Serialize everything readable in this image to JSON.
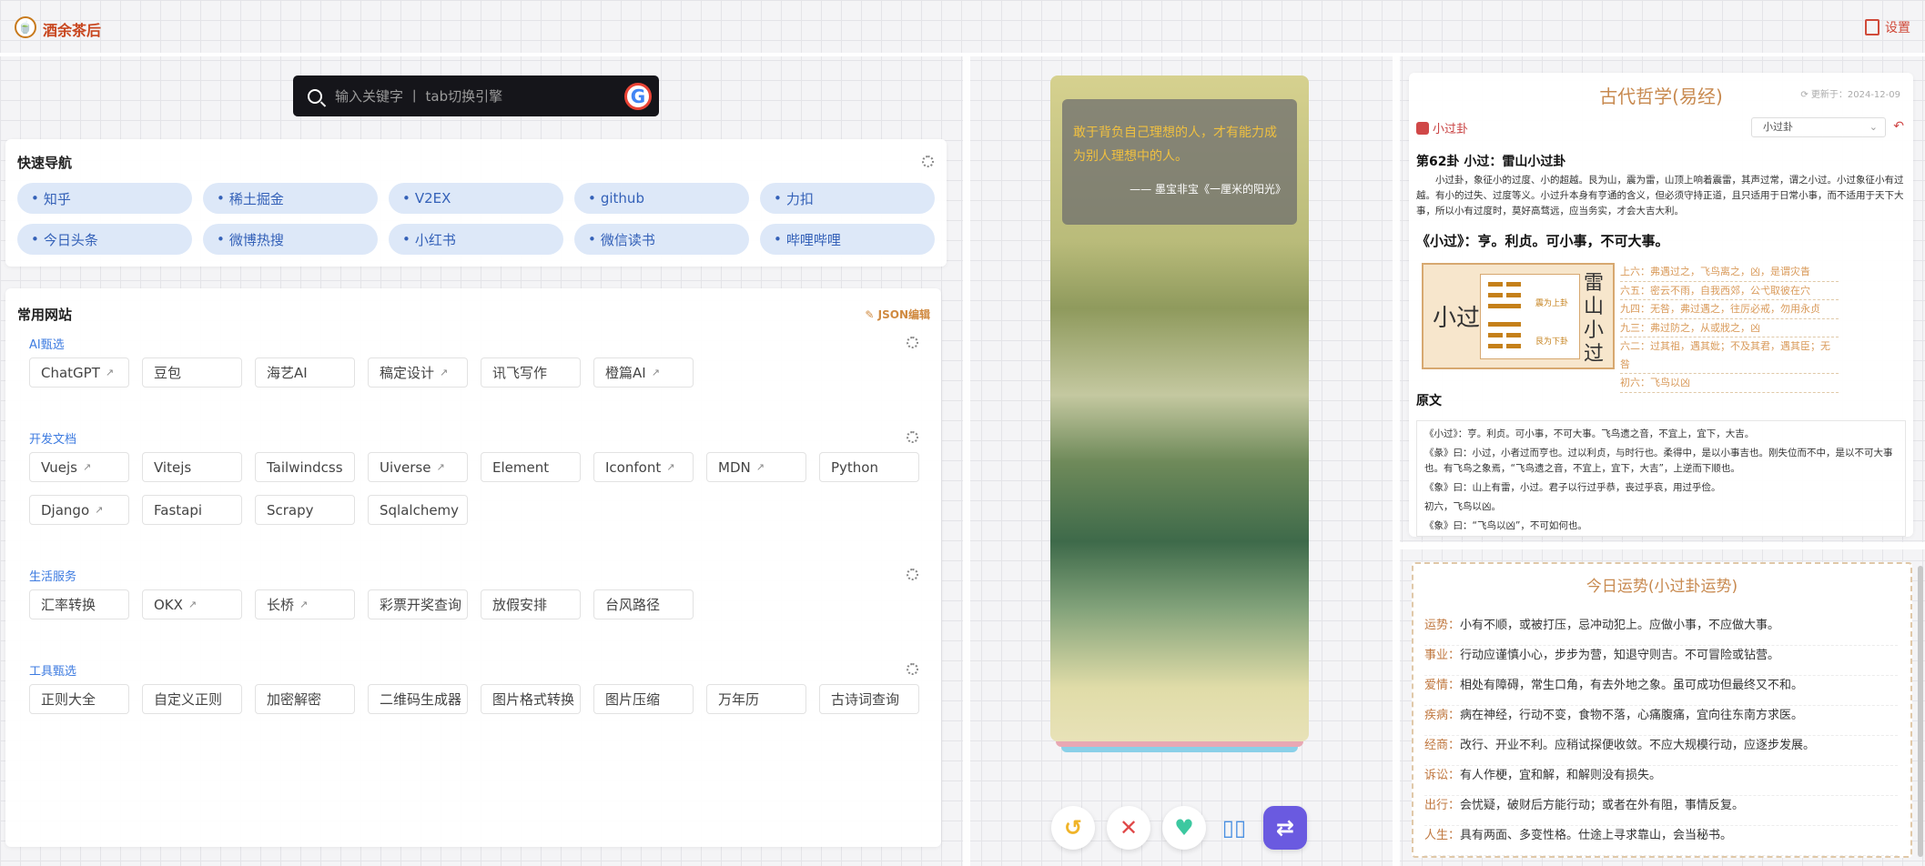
{
  "header": {
    "brand": "酒余茶后",
    "settings_label": "设置"
  },
  "search": {
    "placeholder": "输入关键字 丨 tab切换引擎",
    "engine_icon": "google-icon"
  },
  "quick_nav": {
    "title": "快速导航",
    "items": [
      "知乎",
      "稀土掘金",
      "V2EX",
      "github",
      "力扣",
      "今日头条",
      "微博热搜",
      "小红书",
      "微信读书",
      "哔哩哔哩"
    ]
  },
  "sites": {
    "title": "常用网站",
    "json_edit": "JSON编辑",
    "categories": [
      {
        "name": "AI甄选",
        "items": [
          {
            "label": "ChatGPT",
            "ext": true
          },
          {
            "label": "豆包"
          },
          {
            "label": "海艺AI"
          },
          {
            "label": "稿定设计",
            "ext": true
          },
          {
            "label": "讯飞写作"
          },
          {
            "label": "橙篇AI",
            "ext": true
          }
        ]
      },
      {
        "name": "开发文档",
        "items": [
          {
            "label": "Vuejs",
            "ext": true
          },
          {
            "label": "Vitejs"
          },
          {
            "label": "Tailwindcss"
          },
          {
            "label": "Uiverse",
            "ext": true
          },
          {
            "label": "Element"
          },
          {
            "label": "Iconfont",
            "ext": true
          },
          {
            "label": "MDN",
            "ext": true
          },
          {
            "label": "Python"
          },
          {
            "label": "Django",
            "ext": true
          },
          {
            "label": "Fastapi"
          },
          {
            "label": "Scrapy"
          },
          {
            "label": "Sqlalchemy"
          }
        ]
      },
      {
        "name": "生活服务",
        "items": [
          {
            "label": "汇率转换"
          },
          {
            "label": "OKX",
            "ext": true
          },
          {
            "label": "长桥",
            "ext": true
          },
          {
            "label": "彩票开奖查询"
          },
          {
            "label": "放假安排"
          },
          {
            "label": "台风路径"
          }
        ]
      },
      {
        "name": "工具甄选",
        "items": [
          {
            "label": "正则大全"
          },
          {
            "label": "自定义正则"
          },
          {
            "label": "加密解密"
          },
          {
            "label": "二维码生成器"
          },
          {
            "label": "图片格式转换"
          },
          {
            "label": "图片压缩"
          },
          {
            "label": "万年历"
          },
          {
            "label": "古诗词查询"
          }
        ]
      }
    ]
  },
  "card": {
    "quote": "敢于背负自己理想的人，才有能力成为别人理想中的人。",
    "author": "—— 墨宝非宝《一厘米的阳光》",
    "buttons": [
      "undo-icon",
      "close-icon",
      "heart-icon",
      "book-icon",
      "switch-icon"
    ],
    "colors": {
      "undo": "#f0b429",
      "close": "#e04848",
      "heart": "#3cc8a0",
      "book": "#4a90e2",
      "switch": "#6a5ae0"
    }
  },
  "philosophy": {
    "title": "古代哲学(易经)",
    "updated": "更新于：2024-12-09",
    "gua_tag": "小过卦",
    "select_value": "小过卦",
    "heading": "第62卦 小过：雷山小过卦",
    "intro": "小过卦，象征小的过度、小的超越。艮为山，震为雷，山顶上响着震雷，其声过常，谓之小过。小过象征小有过越。有小的过失、过度等义。小过升本身有亨通的含义，但必须守持正道，且只适用于日常小事，而不适用于天下大事，所以小有过度时，莫好高骛远，应当务实，才会大吉大利。",
    "judgement": "《小过》：亨。利贞。可小事，不可大事。",
    "diagram": {
      "name": "小过",
      "upper": "震为上卦",
      "lower": "艮为下卦",
      "title_chars": [
        "雷",
        "山",
        "小",
        "过"
      ]
    },
    "yao": [
      "上六：弗遇过之，飞鸟离之，凶，是谓灾眚",
      "六五：密云不雨，自我西郊，公弋取彼在穴",
      "九四：无咎，弗过遇之，往厉必戒，勿用永贞",
      "九三：弗过防之，从或戕之，凶",
      "六二：过其祖，遇其妣；不及其君，遇其臣；无咎",
      "初六：飞鸟以凶"
    ],
    "yuanwen_title": "原文",
    "yuanwen": [
      "《小过》：亨。利贞。可小事，不可大事。飞鸟遗之音，不宜上，宜下，大吉。",
      "《彖》曰：小过，小者过而亨也。过以利贞，与时行也。柔得中，是以小事吉也。刚失位而不中，是以不可大事也。有飞鸟之象焉，“飞鸟遗之音，不宜上，宜下，大吉”，上逆而下顺也。",
      "《象》曰：山上有雷，小过。君子以行过乎恭，丧过乎哀，用过乎俭。",
      "初六，飞鸟以凶。",
      "《象》曰：“飞鸟以凶”，不可如何也。"
    ]
  },
  "fortune": {
    "title": "今日运势(小过卦运势)",
    "rows": [
      {
        "k": "运势：",
        "v": "小有不顺，或被打压，忌冲动犯上。应做小事，不应做大事。"
      },
      {
        "k": "事业：",
        "v": "行动应谨慎小心，步步为营，知退守则吉。不可冒险或钻营。"
      },
      {
        "k": "爱情：",
        "v": "相处有障碍，常生口角，有去外地之象。虽可成功但最终又不和。"
      },
      {
        "k": "疾病：",
        "v": "病在神经，行动不变，食物不落，心痛腹痛，宜向往东南方求医。"
      },
      {
        "k": "经商：",
        "v": "改行、开业不利。应稍试探便收敛。不应大规模行动，应逐步发展。"
      },
      {
        "k": "诉讼：",
        "v": "有人作梗，宜和解，和解则没有损失。"
      },
      {
        "k": "出行：",
        "v": "会忧疑，破财后方能行动；或者在外有阻，事情反复。"
      },
      {
        "k": "人生：",
        "v": "具有两面、多变性格。仕途上寻求靠山，会当秘书。"
      }
    ]
  }
}
